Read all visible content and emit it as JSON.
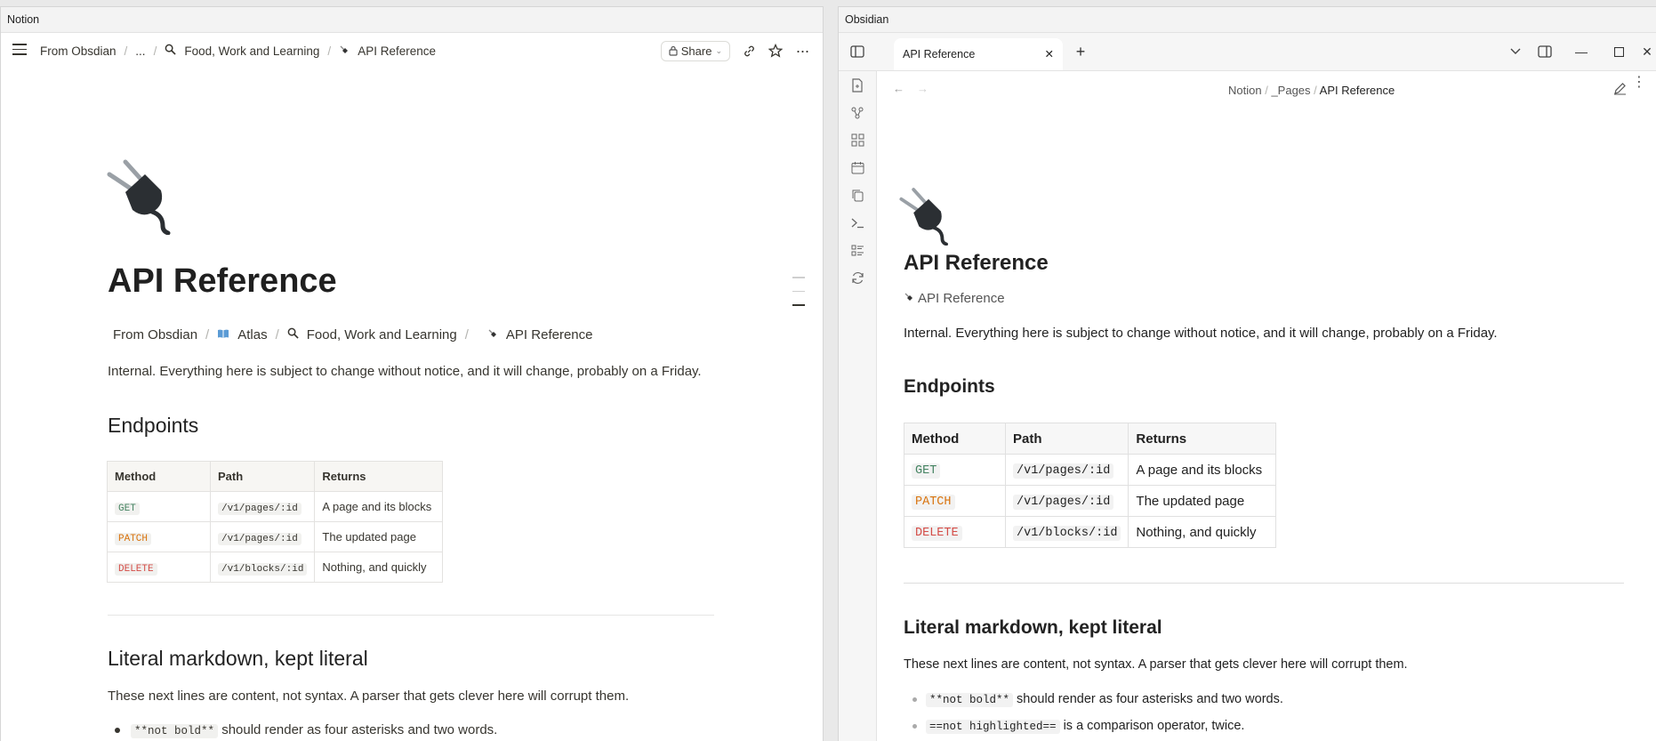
{
  "notion": {
    "window_title": "Notion",
    "breadcrumb": [
      "From Obsdian",
      "...",
      "Food, Work and Learning",
      "API Reference"
    ],
    "share_label": "Share",
    "page": {
      "title": "API Reference",
      "breadcrumb": [
        "From Obsdian",
        "Atlas",
        "Food, Work and Learning",
        "API Reference"
      ],
      "intro": "Internal. Everything here is subject to change without notice, and it will change, probably on a Friday.",
      "endpoints_heading": "Endpoints",
      "table": {
        "headers": [
          "Method",
          "Path",
          "Returns"
        ],
        "rows": [
          {
            "method": "GET",
            "path": "/v1/pages/:id",
            "returns": "A page and its blocks"
          },
          {
            "method": "PATCH",
            "path": "/v1/pages/:id",
            "returns": "The updated page"
          },
          {
            "method": "DELETE",
            "path": "/v1/blocks/:id",
            "returns": "Nothing, and quickly"
          }
        ]
      },
      "literal_heading": "Literal markdown, kept literal",
      "literal_intro": "These next lines are content, not syntax. A parser that gets clever here will corrupt them.",
      "list": [
        {
          "code": "**not bold**",
          "text": "should render as four asterisks and two words."
        }
      ]
    }
  },
  "obsidian": {
    "window_title": "Obsidian",
    "tab_label": "API Reference",
    "breadcrumb": [
      "Notion",
      "_Pages",
      "API Reference"
    ],
    "page": {
      "title": "API Reference",
      "subtitle": "API Reference",
      "intro": "Internal. Everything here is subject to change without notice, and it will change, probably on a Friday.",
      "endpoints_heading": "Endpoints",
      "table": {
        "headers": [
          "Method",
          "Path",
          "Returns"
        ],
        "rows": [
          {
            "method": "GET",
            "path": "/v1/pages/:id",
            "returns": "A page and its blocks"
          },
          {
            "method": "PATCH",
            "path": "/v1/pages/:id",
            "returns": "The updated page"
          },
          {
            "method": "DELETE",
            "path": "/v1/blocks/:id",
            "returns": "Nothing, and quickly"
          }
        ]
      },
      "literal_heading": "Literal markdown, kept literal",
      "literal_intro": "These next lines are content, not syntax. A parser that gets clever here will corrupt them.",
      "list": [
        {
          "code": "**not bold**",
          "text": "should render as four asterisks and two words."
        },
        {
          "code": "==not highlighted==",
          "text": "is a comparison operator, twice."
        }
      ]
    }
  },
  "colors": {
    "get": "#448361",
    "patch": "#d9730d",
    "delete": "#d44c47"
  },
  "icons": [
    "menu-icon",
    "search-icon",
    "plug-icon",
    "link-icon",
    "star-icon",
    "more-icon",
    "book-icon",
    "sidebar-toggle-icon",
    "close-icon",
    "plus-icon",
    "chevron-down-icon",
    "minimize-icon",
    "maximize-icon",
    "back-icon",
    "forward-icon",
    "edit-icon",
    "file-icon",
    "graph-icon",
    "grid-icon",
    "calendar-icon",
    "copy-icon",
    "terminal-icon",
    "list-icon",
    "sync-icon"
  ]
}
